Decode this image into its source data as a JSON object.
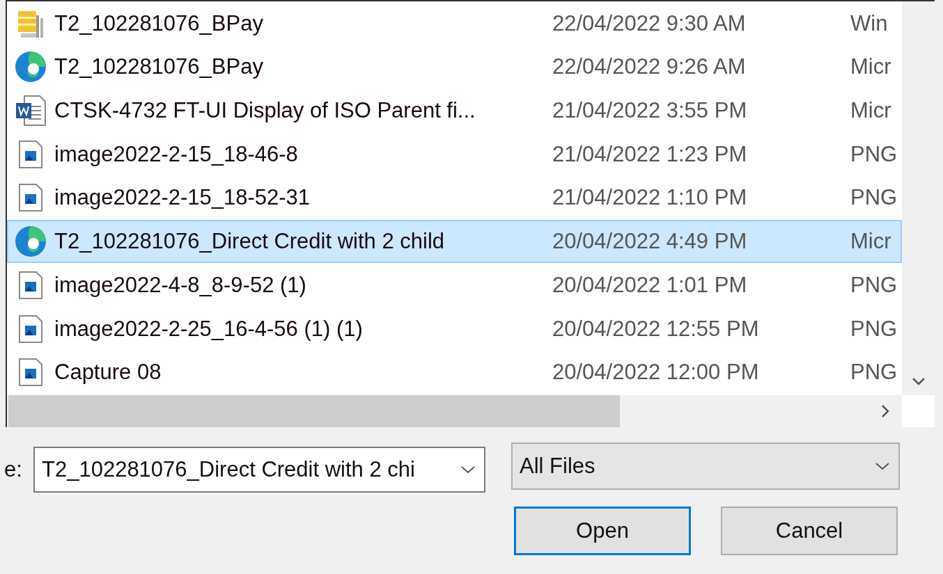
{
  "files": [
    {
      "kind": "archive",
      "name": "T2_102281076_BPay",
      "date": "22/04/2022 9:30 AM",
      "type": "Win",
      "selected": false
    },
    {
      "kind": "browser",
      "name": "T2_102281076_BPay",
      "date": "22/04/2022 9:26 AM",
      "type": "Micr",
      "selected": false
    },
    {
      "kind": "document",
      "name": "CTSK-4732 FT-UI  Display of ISO  Parent fi...",
      "date": "21/04/2022 3:55 PM",
      "type": "Micr",
      "selected": false
    },
    {
      "kind": "image",
      "name": "image2022-2-15_18-46-8",
      "date": "21/04/2022 1:23 PM",
      "type": "PNG",
      "selected": false
    },
    {
      "kind": "image",
      "name": "image2022-2-15_18-52-31",
      "date": "21/04/2022 1:10 PM",
      "type": "PNG",
      "selected": false
    },
    {
      "kind": "browser",
      "name": "T2_102281076_Direct Credit with 2 child",
      "date": "20/04/2022 4:49 PM",
      "type": "Micr",
      "selected": true
    },
    {
      "kind": "image",
      "name": "image2022-4-8_8-9-52 (1)",
      "date": "20/04/2022 1:01 PM",
      "type": "PNG",
      "selected": false
    },
    {
      "kind": "image",
      "name": "image2022-2-25_16-4-56 (1) (1)",
      "date": "20/04/2022 12:55 PM",
      "type": "PNG",
      "selected": false
    },
    {
      "kind": "image",
      "name": "Capture 08",
      "date": "20/04/2022 12:00 PM",
      "type": "PNG",
      "selected": false
    }
  ],
  "file_name": {
    "label": "e:",
    "value": "T2_102281076_Direct Credit with 2 chi"
  },
  "filter": {
    "value": "All Files"
  },
  "buttons": [
    {
      "label": "Open",
      "selected": true
    },
    {
      "label": "Cancel",
      "selected": false
    }
  ]
}
